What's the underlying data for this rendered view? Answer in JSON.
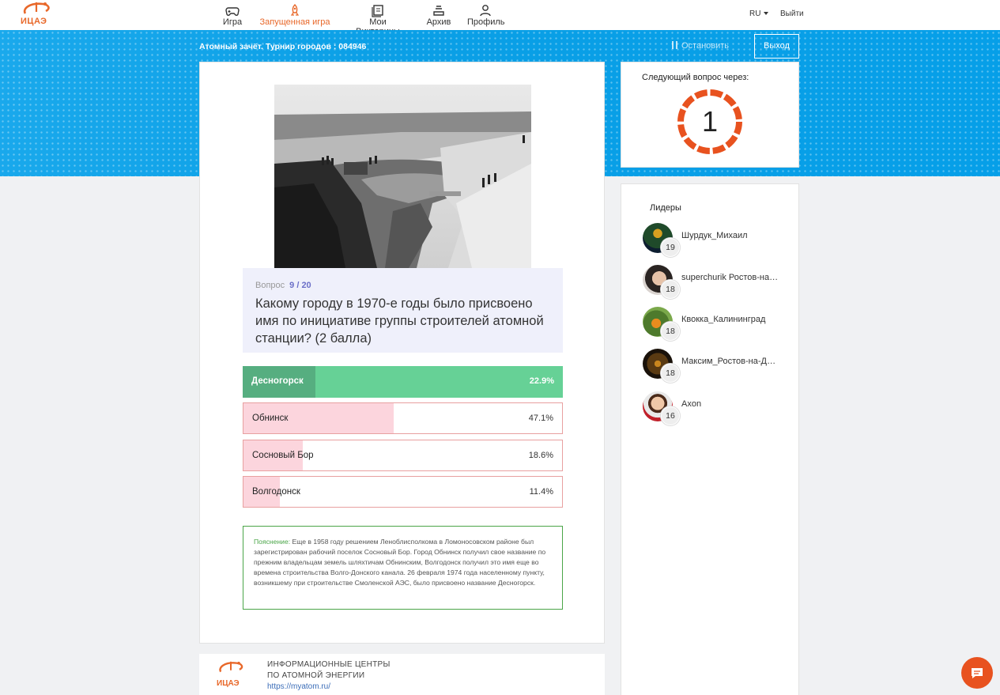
{
  "nav": {
    "logo_text": "ИЦАЭ",
    "items": [
      {
        "label": "Игра",
        "icon": "gamepad-icon",
        "active": false
      },
      {
        "label": "Запущенная игра",
        "icon": "rocket-icon",
        "active": true
      },
      {
        "label": "Мои Викторины",
        "icon": "quizzes-icon",
        "active": false
      },
      {
        "label": "Архив",
        "icon": "archive-icon",
        "active": false
      },
      {
        "label": "Профиль",
        "icon": "user-icon",
        "active": false
      }
    ],
    "language": "RU",
    "logout": "Выйти"
  },
  "game": {
    "title": "Атомный зачёт. Турнир городов : 084946",
    "pause_label": "Остановить",
    "exit_label": "Выход"
  },
  "question": {
    "label": "Вопрос",
    "number": "9 / 20",
    "text": "Какому городу в 1970-е годы было присвоено имя по инициативе группы строителей атомной станции? (2 балла)"
  },
  "answers": [
    {
      "label": "Десногорск",
      "percent": "22.9%",
      "fill": 0.229,
      "correct": true
    },
    {
      "label": "Обнинск",
      "percent": "47.1%",
      "fill": 0.471,
      "correct": false
    },
    {
      "label": "Сосновый Бор",
      "percent": "18.6%",
      "fill": 0.186,
      "correct": false
    },
    {
      "label": "Волгодонск",
      "percent": "11.4%",
      "fill": 0.114,
      "correct": false
    }
  ],
  "explanation": {
    "heading": "Пояснение:",
    "text": "Еще в 1958 году решением Ленoблисполкома в Ломоносовском районе был зарегистрирован рабочий поселок Сосновый Бор. Город Обнинск получил свое название по прежним владельцам земель шляхтичам Обнинским, Волгодонск получил это имя еще во времена строительства Волго-Донского канала. 26 февраля 1974 года населенному пункту, возникшему при строительстве Смоленской АЭС, было присвоено название Десногорск."
  },
  "timer": {
    "title": "Следующий вопрос через:",
    "value": "1",
    "color": "#e8521f"
  },
  "leaders": {
    "title": "Лидеры",
    "items": [
      {
        "name": "Шурдук_Михаил",
        "score": "19"
      },
      {
        "name": "superchurik Ростов-на-Дону",
        "score": "18"
      },
      {
        "name": "Квокка_Калининград",
        "score": "18"
      },
      {
        "name": "Максим_Ростов-на-Дону",
        "score": "18"
      },
      {
        "name": "Axon",
        "score": "16"
      }
    ]
  },
  "footer": {
    "line1": "ИНФОРМАЦИОННЫЕ ЦЕНТРЫ",
    "line2": "ПО АТОМНОЙ ЭНЕРГИИ",
    "link": "https://myatom.ru/",
    "logo_text": "ИЦАЭ"
  },
  "colors": {
    "accent": "#e8682a",
    "band": "#0da3ea",
    "correct": "#66d196",
    "wrong_fill": "#fcd5dd"
  }
}
